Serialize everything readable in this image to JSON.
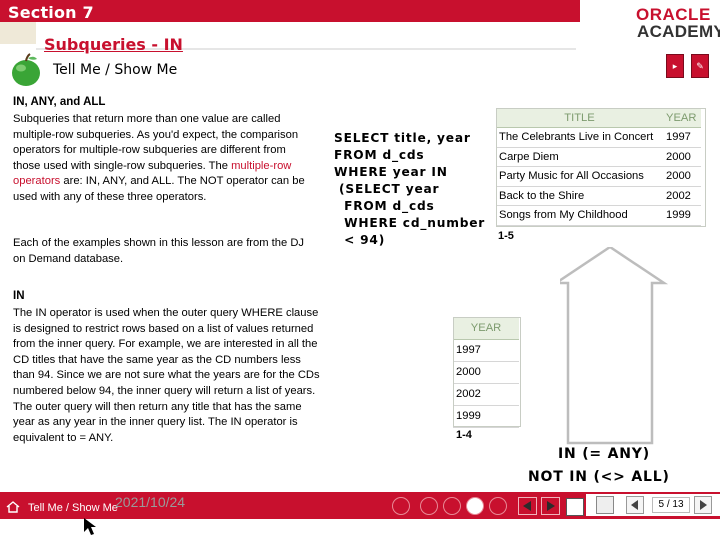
{
  "header": {
    "section": "Section 7",
    "title": "Subqueries - IN",
    "brand_top": "ORACLE",
    "brand_bottom": "ACADEMY"
  },
  "tell_me": "Tell Me / Show Me",
  "intro": {
    "heading": "IN, ANY, and ALL",
    "p1_lines": [
      "Subqueries that return more than one value are called",
      "multiple-row subqueries. As you'd expect, the comparison",
      "operators for multiple-row subqueries are different from",
      "those used with single-row subqueries. The ",
      "multiple-row",
      "operators",
      " are: IN, ANY, and ALL. The NOT operator can be",
      "used with any of these three operators."
    ],
    "p2_lines": [
      "Each of the examples shown in this lesson are from the DJ",
      "on Demand database."
    ]
  },
  "in_section": {
    "heading": "IN",
    "lines": [
      "The IN operator is used when the outer query WHERE clause",
      "is designed to restrict rows based on a list of values returned",
      "from the inner query. For example, we are interested in all  the",
      "CD titles that have the same year as the CD numbers less",
      "than 94. Since we are not sure what the years are for the CDs",
      "numbered below 94, the inner query will return a list of years.",
      "The outer query will then return any title that has the same",
      "year as any year in the inner query list. The IN operator is",
      "equivalent to = ANY."
    ]
  },
  "sql_lines": [
    "SELECT title, year",
    "FROM d_cds",
    "WHERE year IN",
    " (SELECT year",
    "  FROM d_cds",
    "  WHERE cd_number",
    "  < 94)"
  ],
  "table_results": {
    "headers": [
      "TITLE",
      "YEAR"
    ],
    "rows": [
      [
        "The Celebrants Live in Concert",
        "1997"
      ],
      [
        "Carpe Diem",
        "2000"
      ],
      [
        "Party Music for All Occasions",
        "2000"
      ],
      [
        "Back to the Shire",
        "2002"
      ],
      [
        "Songs from My Childhood",
        "1999"
      ]
    ],
    "label": "1-5"
  },
  "table_years": {
    "header": "YEAR",
    "rows": [
      "1997",
      "2000",
      "2002",
      "1999"
    ],
    "label": "1-4"
  },
  "equivalences": {
    "line1": "IN (= ANY)",
    "line2": "NOT IN (<> ALL)"
  },
  "footer": {
    "label": "Tell Me / Show Me",
    "date": "2021/10/24",
    "page": "5 / 13"
  },
  "colors": {
    "brand_red": "#c8102e",
    "table_header_bg": "#e9f0e2",
    "table_header_text": "#7d9b6e"
  }
}
